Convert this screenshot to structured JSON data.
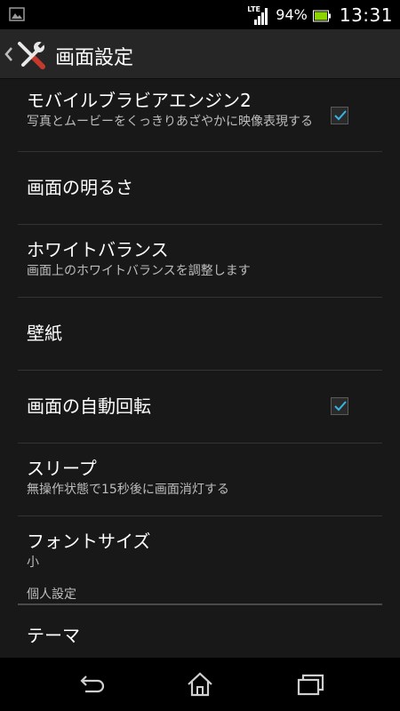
{
  "status_bar": {
    "network": "LTE",
    "battery": "94%",
    "time": "13:31",
    "left_icon": "image-icon"
  },
  "action_bar": {
    "title": "画面設定",
    "icon": "tools-icon"
  },
  "settings": [
    {
      "title": "モバイルブラビアエンジン2",
      "summary": "写真とムービーをくっきりあざやかに映像表現する",
      "checkbox": true
    },
    {
      "title": "画面の明るさ",
      "summary": ""
    },
    {
      "title": "ホワイトバランス",
      "summary": "画面上のホワイトバランスを調整します"
    },
    {
      "title": "壁紙",
      "summary": ""
    },
    {
      "title": "画面の自動回転",
      "summary": "",
      "checkbox": true
    },
    {
      "title": "スリープ",
      "summary": "無操作状態で15秒後に画面消灯する"
    },
    {
      "title": "フォントサイズ",
      "summary": "小"
    }
  ],
  "section": {
    "label": "個人設定"
  },
  "after_section": [
    {
      "title": "テーマ"
    }
  ],
  "nav_bar": {
    "back": "back-icon",
    "home": "home-icon",
    "recents": "recents-icon"
  },
  "colors": {
    "accent": "#33b5e5",
    "background": "#181818"
  }
}
